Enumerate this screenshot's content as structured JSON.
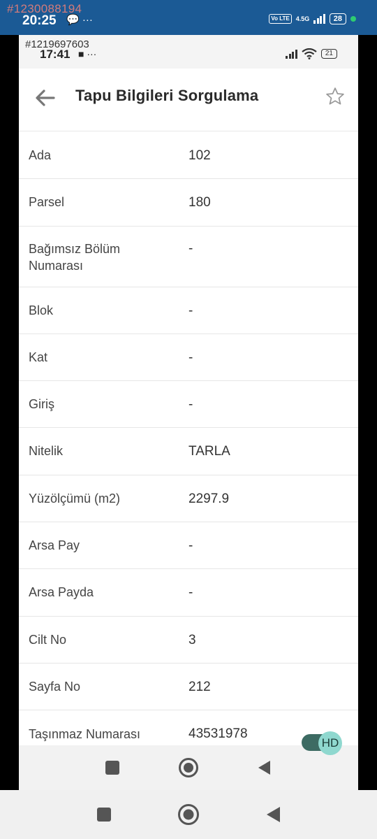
{
  "outer_status": {
    "watermark": "#1230088194",
    "time": "20:25",
    "notification_glyph": "💬 ···",
    "volte": "Vo LTE",
    "network": "4.5G",
    "battery": "28",
    "colors": {
      "bar": "#1b5a95",
      "dot": "#2ecc71",
      "watermark": "#d27b7b"
    }
  },
  "inner_status": {
    "watermark": "#1219697603",
    "time": "17:41",
    "notification_glyph": "■ ···",
    "battery": "21"
  },
  "appbar": {
    "title": "Tapu Bilgileri Sorgulama",
    "back_icon": "arrow-left-icon",
    "favorite_icon": "star-outline-icon"
  },
  "rows": [
    {
      "label": "Ada",
      "value": "102"
    },
    {
      "label": "Parsel",
      "value": "180"
    },
    {
      "label": "Bağımsız Bölüm Numarası",
      "value": "-"
    },
    {
      "label": "Blok",
      "value": "-"
    },
    {
      "label": "Kat",
      "value": "-"
    },
    {
      "label": "Giriş",
      "value": "-"
    },
    {
      "label": "Nitelik",
      "value": "TARLA"
    },
    {
      "label": "Yüzölçümü (m2)",
      "value": "2297.9"
    },
    {
      "label": "Arsa Pay",
      "value": "-"
    },
    {
      "label": "Arsa Payda",
      "value": "-"
    },
    {
      "label": "Cilt No",
      "value": "3"
    },
    {
      "label": "Sayfa No",
      "value": "212"
    },
    {
      "label": "Taşınmaz Numarası",
      "value": "43531978"
    }
  ],
  "hd_toggle": {
    "label": "HD",
    "state": "on"
  },
  "nav_icons": [
    "square-recents-icon",
    "circle-home-icon",
    "triangle-back-icon"
  ]
}
